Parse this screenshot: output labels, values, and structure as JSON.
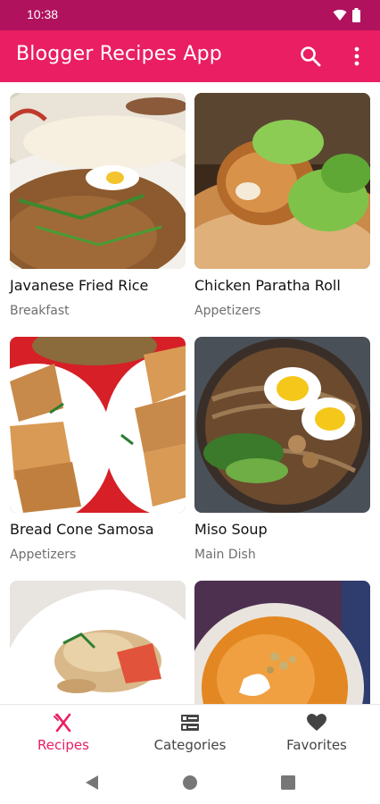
{
  "status_bar": {
    "time": "10:38"
  },
  "app_bar": {
    "title": "Blogger Recipes App"
  },
  "recipes": [
    {
      "title": "Javanese Fried Rice",
      "category": "Breakfast"
    },
    {
      "title": "Chicken Paratha Roll",
      "category": "Appetizers"
    },
    {
      "title": "Bread Cone Samosa",
      "category": "Appetizers"
    },
    {
      "title": "Miso Soup",
      "category": "Main Dish"
    },
    {
      "title": "",
      "category": ""
    },
    {
      "title": "",
      "category": ""
    }
  ],
  "bottom_nav": {
    "items": [
      {
        "label": "Recipes",
        "icon": "fork-knife-icon",
        "active": true
      },
      {
        "label": "Categories",
        "icon": "list-icon",
        "active": false
      },
      {
        "label": "Favorites",
        "icon": "heart-icon",
        "active": false
      }
    ]
  },
  "colors": {
    "primary": "#e91e63",
    "primary_dark": "#b0125e"
  }
}
